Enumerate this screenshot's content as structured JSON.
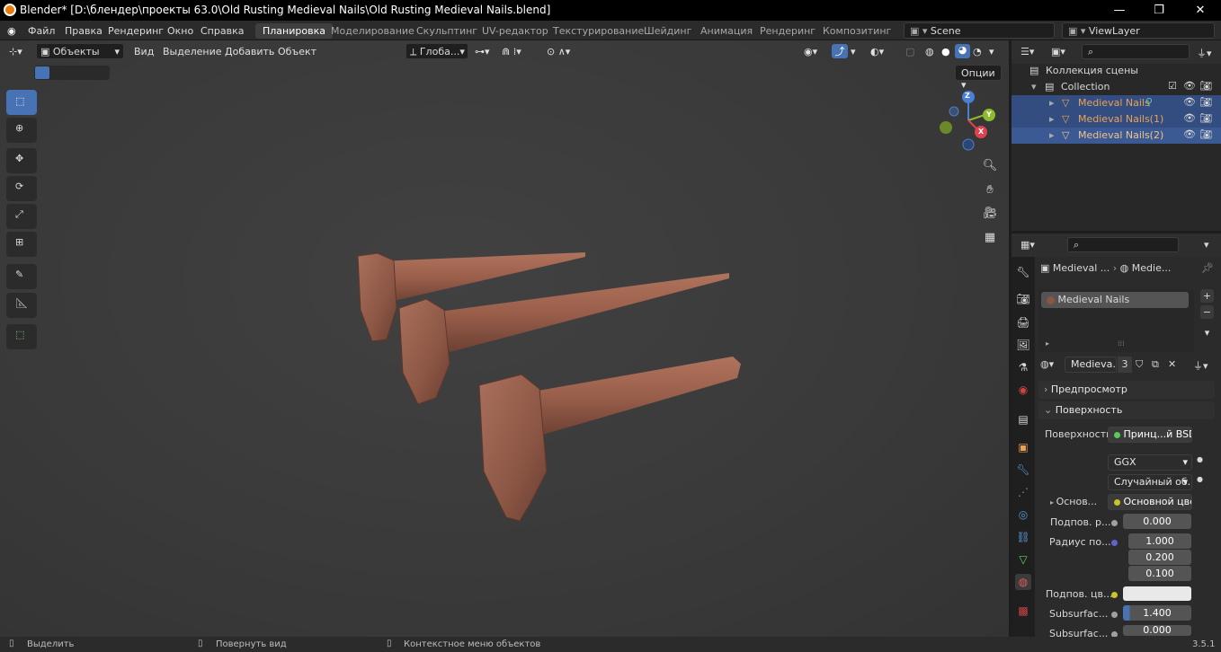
{
  "window": {
    "title": "Blender* [D:\\блендер\\проекты 63.0\\Old Rusting Medieval Nails\\Old Rusting Medieval Nails.blend]",
    "minimize": "—",
    "maximize": "❐",
    "close": "✕"
  },
  "menu": [
    "Файл",
    "Правка",
    "Рендеринг",
    "Окно",
    "Справка"
  ],
  "workspaces": [
    "Планировка",
    "Моделирование",
    "Скульптинг",
    "UV-редактор",
    "Текстурирование",
    "Шейдинг",
    "Анимация",
    "Рендеринг",
    "Композитинг"
  ],
  "active_workspace": "Планировка",
  "scene": "Scene",
  "view_layer": "ViewLayer",
  "viewport": {
    "mode": "Объекты",
    "menus": [
      "Вид",
      "Выделение",
      "Добавить",
      "Объект"
    ],
    "transform_orientation": "Глоба...",
    "options": "Опции",
    "gizmo": {
      "x": "X",
      "y": "Y",
      "z": "Z"
    }
  },
  "outliner": {
    "scene_collection": "Коллекция сцены",
    "collection": "Collection",
    "objects": [
      "Medieval Nails",
      "Medieval Nails(1)",
      "Medieval Nails(2)"
    ]
  },
  "properties": {
    "breadcrumb_obj": "Medieval ...",
    "breadcrumb_mat": "Medie...",
    "material_slot": "Medieval Nails",
    "material_name": "Medieva...",
    "users": "3",
    "panels": {
      "preview": "Предпросмотр",
      "surface": "Поверхность"
    },
    "surface_label": "Поверхность",
    "surface_value": "Принц...й BSDF",
    "distribution": "GGX",
    "subsurface_method": "Случайный об...",
    "base_label": "Основ...",
    "base_value": "Основной цвет",
    "subsurface_label": "Подпов. р...",
    "subsurface_value": "0.000",
    "radius_label": "Радиус по...",
    "radius_values": [
      "1.000",
      "0.200",
      "0.100"
    ],
    "subsurface_color_label": "Подпов. цв...",
    "ior_label": "Subsurfac...",
    "ior_value": "1.400",
    "aniso_label": "Subsurfac...",
    "aniso_value": "0.000"
  },
  "statusbar": {
    "select": "Выделить",
    "rotate": "Повернуть вид",
    "context": "Контекстное меню объектов",
    "version": "3.5.1"
  },
  "colors": {
    "accent": "#4772b3",
    "selected_row": "#334d80",
    "object_orange": "#e8a25a"
  }
}
